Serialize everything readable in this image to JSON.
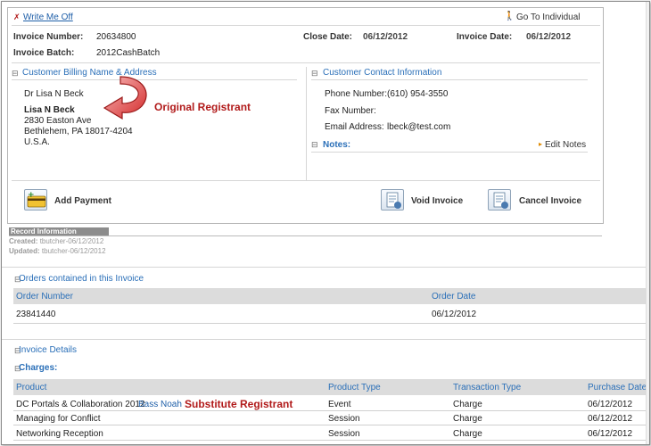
{
  "header": {
    "write_me_off": "Write Me Off",
    "go_to_individual": "Go To Individual",
    "invoice_number_label": "Invoice Number:",
    "invoice_number": "20634800",
    "close_date_label": "Close Date:",
    "close_date": "06/12/2012",
    "invoice_date_label": "Invoice Date:",
    "invoice_date": "06/12/2012",
    "invoice_batch_label": "Invoice Batch:",
    "invoice_batch": "2012CashBatch"
  },
  "billing": {
    "title": "Customer Billing Name & Address",
    "name_line": "Dr Lisa N Beck",
    "name_bold": "Lisa N Beck",
    "street": "2830 Easton Ave",
    "city": "Bethlehem, PA 18017-4204",
    "country": "U.S.A."
  },
  "annotation": {
    "original": "Original Registrant",
    "substitute": "Substitute Registrant"
  },
  "contact": {
    "title": "Customer Contact Information",
    "phone_label": "Phone Number:",
    "phone": "(610) 954-3550",
    "fax_label": "Fax Number:",
    "fax": "",
    "email_label": "Email Address:",
    "email": "lbeck@test.com",
    "notes_title": "Notes:",
    "edit_notes": "Edit Notes"
  },
  "actions": {
    "add_payment": "Add Payment",
    "void_invoice": "Void Invoice",
    "cancel_invoice": "Cancel Invoice"
  },
  "record": {
    "tab": "Record Information",
    "created_label": "Created:",
    "created": "tbutcher-06/12/2012",
    "updated_label": "Updated:",
    "updated": "tbutcher-06/12/2012"
  },
  "orders": {
    "title": "Orders contained in this Invoice",
    "columns": [
      "Order Number",
      "Order Date"
    ],
    "rows": [
      {
        "number": "23841440",
        "date": "06/12/2012"
      }
    ]
  },
  "details": {
    "title": "Invoice Details",
    "charges_title": "Charges:",
    "columns": [
      "Product",
      "Product Type",
      "Transaction Type",
      "Purchase Date"
    ],
    "rows": [
      {
        "product": "DC Portals & Collaboration 2012",
        "extra": "Bass Noah",
        "type": "Event",
        "transaction": "Charge",
        "date": "06/12/2012"
      },
      {
        "product": "Managing for Conflict",
        "extra": "",
        "type": "Session",
        "transaction": "Charge",
        "date": "06/12/2012"
      },
      {
        "product": "Networking Reception",
        "extra": "",
        "type": "Session",
        "transaction": "Charge",
        "date": "06/12/2012"
      }
    ]
  },
  "colors": {
    "accent": "#2a6fb8",
    "annotation_red": "#b11a1a"
  }
}
